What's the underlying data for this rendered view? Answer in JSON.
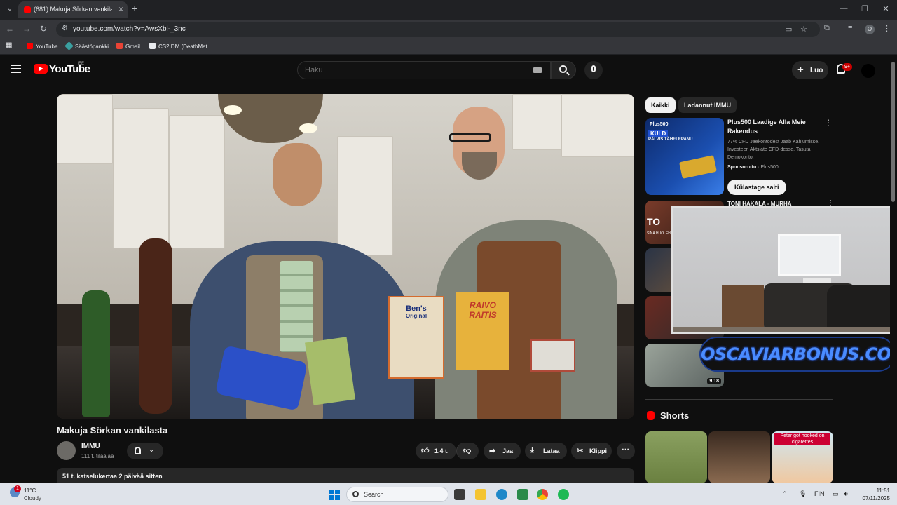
{
  "browser": {
    "tab_title": "(681) Makuja Sörkan vankilasta",
    "url": "youtube.com/watch?v=AwsXbl-_3nc",
    "bookmarks": [
      "YouTube",
      "Säästöpankki",
      "Gmail",
      "CS2 DM (DeathMat..."
    ],
    "profile_initial": "O",
    "icons": [
      "tab-search-icon",
      "new-tab-icon",
      "minimize-icon",
      "restore-icon",
      "close-window-icon",
      "back-icon",
      "forward-icon",
      "reload-icon",
      "site-info-icon",
      "cast-icon",
      "star-icon",
      "extensions-icon",
      "reading-list-icon",
      "kebab-icon",
      "apps-icon"
    ]
  },
  "header": {
    "logo_text": "YouTube",
    "region": "EE",
    "search_placeholder": "Haku",
    "create_label": "Luo",
    "notification_count": "9+"
  },
  "video": {
    "title": "Makuja Sörkan vankilasta",
    "channel": "IMMU",
    "subscribers": "111 t. tilaajaa",
    "likes": "1,4 t.",
    "share_label": "Jaa",
    "download_label": "Lataa",
    "clip_label": "Klippi",
    "views_date": "51 t. katselukertaa  2 päivää sitten",
    "scene_text": {
      "rice_brand": "Ben's",
      "rice_sub": "Original",
      "book_title": "RAIVO RAITIS"
    }
  },
  "sidebar": {
    "chips": [
      "Kaikki",
      "Ladannut IMMU"
    ],
    "ad": {
      "brand": "Plus500",
      "thumb_headline": "KULD",
      "thumb_sub": "PÄLVIS TÄHELEPANU",
      "title": "Plus500 Laadige Alla Meie Rakendus",
      "description": "77% CFD Jaekontodest Jääb Kahjumisse. Investeeri Aktsiate CFD-desse. Tasuta Demokonto.",
      "sponsored": "Sponsoroitu",
      "advertiser": "Plus500",
      "cta": "Külastage saiti"
    },
    "related_partial_title": "TONI HAKALA - MURHA",
    "thumb_overlay_text": "TO",
    "thumb_overlay_sub": "SINÄ HUOLEH HUOMENNA",
    "last_duration": "9.18",
    "promo_text": "OSCAVIARBONUS.COM",
    "shorts_title": "Shorts",
    "short3_caption": "Peter got hooked on cigarettes"
  },
  "taskbar": {
    "weather_alert": "1",
    "temperature": "11°C",
    "condition": "Cloudy",
    "search_label": "Search",
    "language": "FIN",
    "time": "11:51",
    "date": "07/11/2025"
  },
  "colors": {
    "yt_red": "#ff0000",
    "background": "#0f0f0f",
    "surface": "#272727",
    "promo_blue": "#4a8cff"
  }
}
